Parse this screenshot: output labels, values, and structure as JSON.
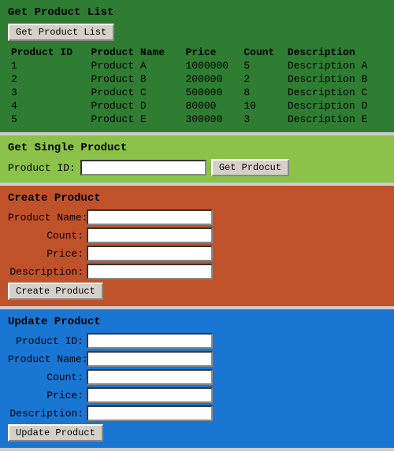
{
  "sections": {
    "get_list": {
      "title": "Get Product List",
      "button_label": "Get Product List",
      "table": {
        "headers": [
          "Product ID",
          "Product Name",
          "Price",
          "Count",
          "Description"
        ],
        "rows": [
          {
            "id": "1",
            "name": "Product A",
            "price": "1000000",
            "count": "5",
            "description": "Description A"
          },
          {
            "id": "2",
            "name": "Product B",
            "price": "200000",
            "count": "2",
            "description": "Description B"
          },
          {
            "id": "3",
            "name": "Product C",
            "price": "500000",
            "count": "8",
            "description": "Description C"
          },
          {
            "id": "4",
            "name": "Product D",
            "price": "80000",
            "count": "10",
            "description": "Description D"
          },
          {
            "id": "5",
            "name": "Product E",
            "price": "300000",
            "count": "3",
            "description": "Description E"
          }
        ]
      }
    },
    "get_single": {
      "title": "Get Single Product",
      "label": "Product ID:",
      "button_label": "Get Prdocut",
      "input_placeholder": ""
    },
    "create": {
      "title": "Create Product",
      "fields": [
        {
          "label": "Product Name:"
        },
        {
          "label": "Count:"
        },
        {
          "label": "Price:"
        },
        {
          "label": "Description:"
        }
      ],
      "button_label": "Create Product"
    },
    "update": {
      "title": "Update Product",
      "fields": [
        {
          "label": "Product ID:"
        },
        {
          "label": "Product Name:"
        },
        {
          "label": "Count:"
        },
        {
          "label": "Price:"
        },
        {
          "label": "Description:"
        }
      ],
      "button_label": "Update Product"
    }
  }
}
